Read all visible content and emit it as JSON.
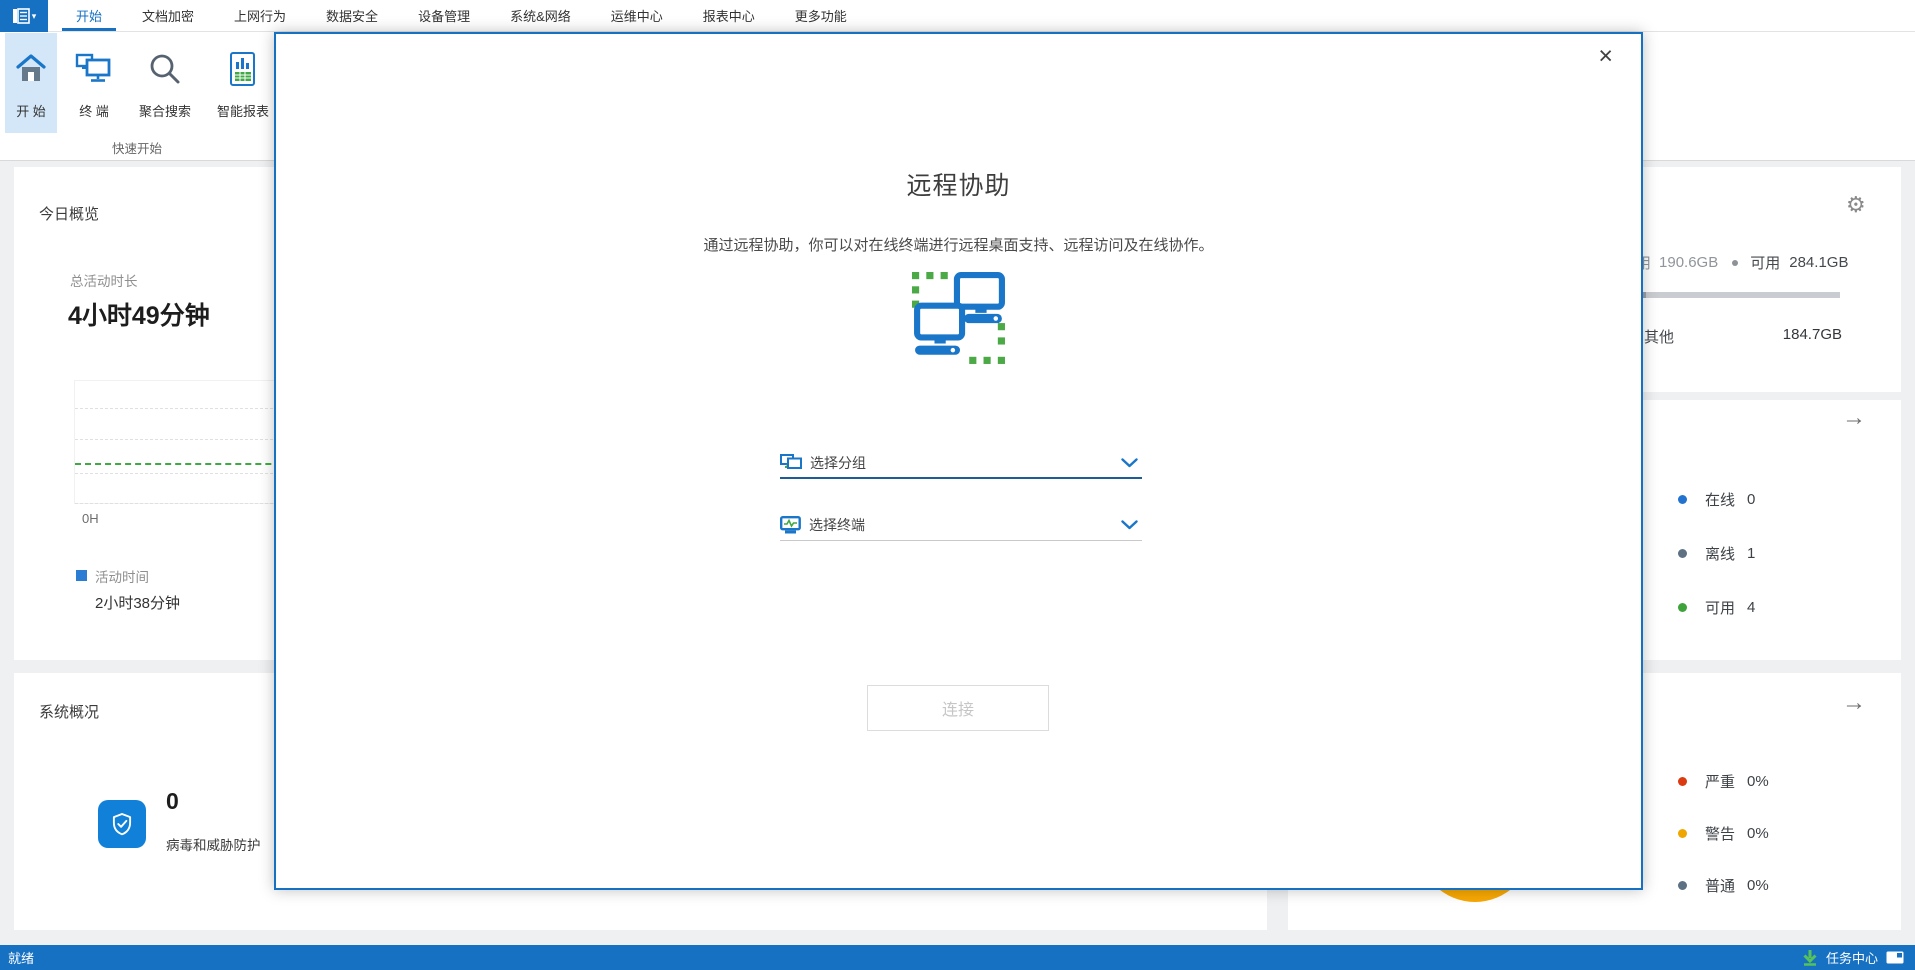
{
  "menubar": {
    "items": [
      "开始",
      "文档加密",
      "上网行为",
      "数据安全",
      "设备管理",
      "系统&网络",
      "运维中心",
      "报表中心",
      "更多功能"
    ],
    "active_item": "开始"
  },
  "ribbon": {
    "buttons": [
      {
        "label": "开 始"
      },
      {
        "label": "终 端"
      },
      {
        "label": "聚合搜索"
      },
      {
        "label": "智能报表"
      }
    ],
    "group_label": "快速开始"
  },
  "overview": {
    "title": "今日概览",
    "total_label": "总活动时长",
    "total_value": "4小时49分钟",
    "axis_label": "0H",
    "legend_label": "活动时间",
    "legend_value": "2小时38分钟"
  },
  "system": {
    "title": "系统概况",
    "virus_count": "0",
    "virus_label": "病毒和威胁防护"
  },
  "storage": {
    "used_label": "用",
    "used_value": "190.6GB",
    "avail_label": "可用",
    "avail_value": "284.1GB",
    "other_label": "其他",
    "other_value": "184.7GB"
  },
  "terminal_stats": {
    "items": [
      {
        "label": "在线",
        "value": "0",
        "color": "#2273d0"
      },
      {
        "label": "离线",
        "value": "1",
        "color": "#5d7183"
      },
      {
        "label": "可用",
        "value": "4",
        "color": "#3ea33b"
      }
    ]
  },
  "alarm_stats": {
    "items": [
      {
        "label": "严重",
        "value": "0%",
        "color": "#dc3a10"
      },
      {
        "label": "警告",
        "value": "0%",
        "color": "#f0a600"
      },
      {
        "label": "普通",
        "value": "0%",
        "color": "#5d7183"
      }
    ],
    "donut_color": "#f7a804"
  },
  "modal": {
    "title": "远程协助",
    "description": "通过远程协助，你可以对在线终端进行远程桌面支持、远程访问及在线协作。",
    "group_placeholder": "选择分组",
    "terminal_placeholder": "选择终端",
    "connect_label": "连接",
    "close_glyph": "×"
  },
  "statusbar": {
    "ready": "就绪",
    "task_center": "任务中心"
  },
  "colors": {
    "accent_blue": "#1671c3",
    "icon_blue": "#1976c8",
    "green": "#3faa44"
  }
}
